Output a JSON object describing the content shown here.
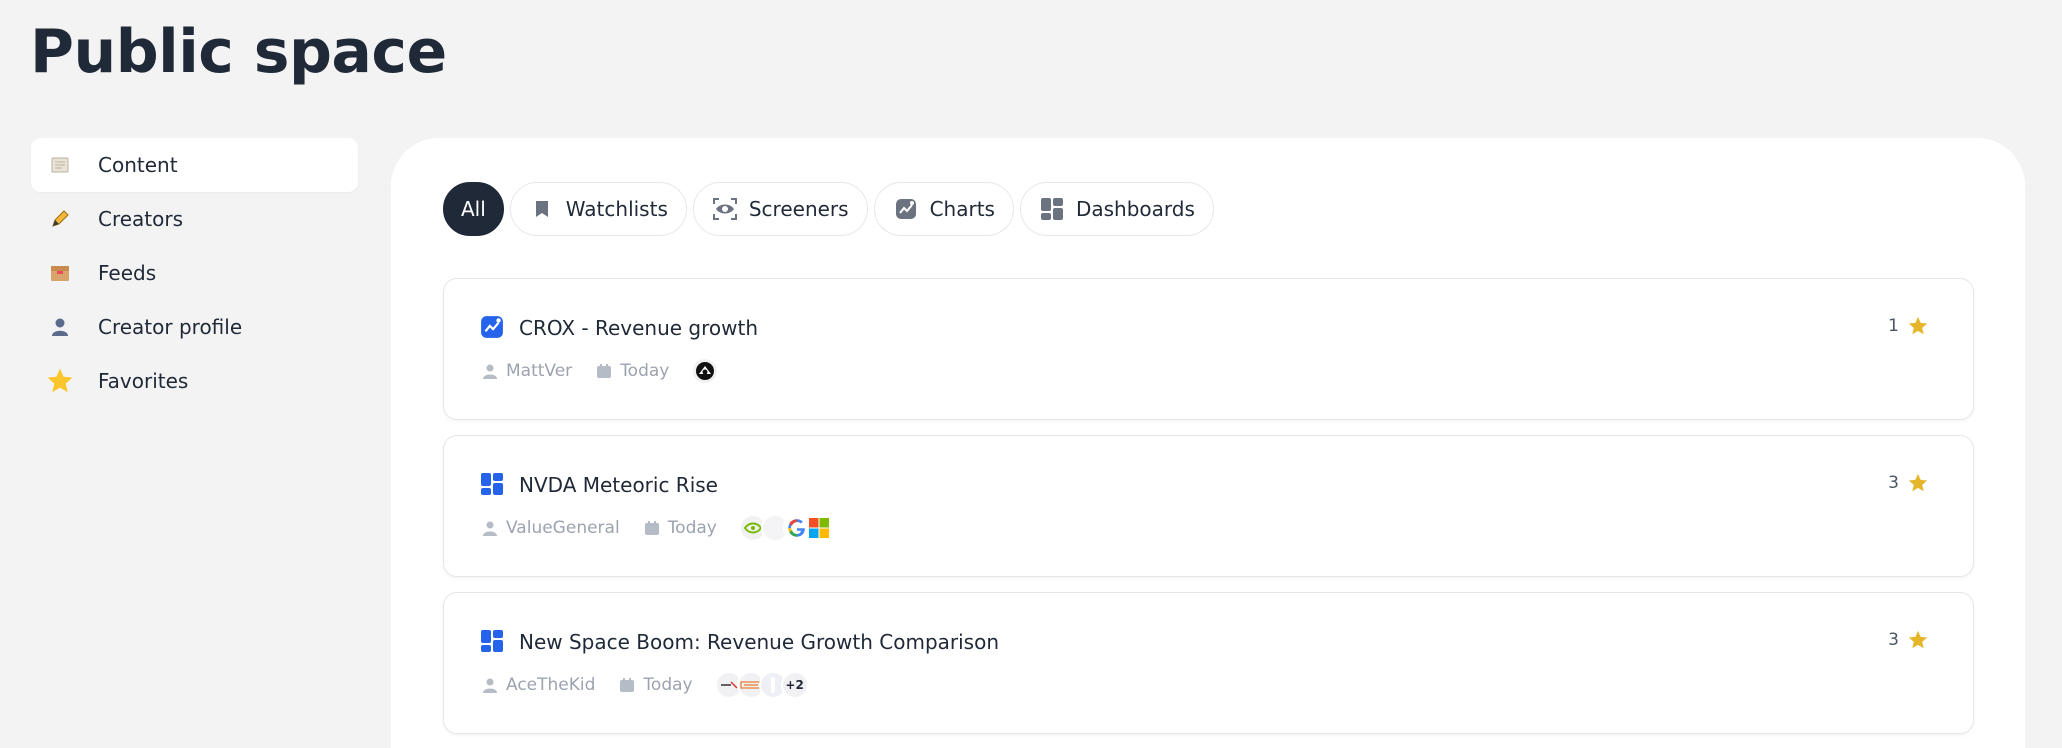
{
  "page": {
    "title": "Public space"
  },
  "sidebar": {
    "items": [
      {
        "label": "Content",
        "icon": "scroll-icon",
        "active": true
      },
      {
        "label": "Creators",
        "icon": "pencil-icon",
        "active": false
      },
      {
        "label": "Feeds",
        "icon": "box-icon",
        "active": false
      },
      {
        "label": "Creator profile",
        "icon": "person-icon",
        "active": false
      },
      {
        "label": "Favorites",
        "icon": "star-icon",
        "active": false
      }
    ]
  },
  "filters": {
    "items": [
      {
        "label": "All",
        "active": true
      },
      {
        "label": "Watchlists",
        "icon": "bookmark-icon",
        "active": false
      },
      {
        "label": "Screeners",
        "icon": "eye-icon",
        "active": false
      },
      {
        "label": "Charts",
        "icon": "chart-icon",
        "active": false
      },
      {
        "label": "Dashboards",
        "icon": "dashboard-icon",
        "active": false
      }
    ]
  },
  "cards": [
    {
      "title": "CROX - Revenue growth",
      "type": "chart",
      "author": "MattVer",
      "date": "Today",
      "count": "1",
      "logos": [
        "crox"
      ],
      "more": ""
    },
    {
      "title": "NVDA Meteoric Rise",
      "type": "dashboard",
      "author": "ValueGeneral",
      "date": "Today",
      "count": "3",
      "logos": [
        "nvidia",
        "apple",
        "google",
        "microsoft"
      ],
      "more": ""
    },
    {
      "title": "New Space Boom: Revenue Growth Comparison",
      "type": "dashboard",
      "author": "AceTheKid",
      "date": "Today",
      "count": "3",
      "logos": [
        "spacex",
        "rklb",
        "asts"
      ],
      "more": "+2"
    }
  ],
  "colors": {
    "accent": "#2563eb",
    "star": "#e5b52a",
    "dark": "#1f2937",
    "muted": "#9ca3af"
  }
}
